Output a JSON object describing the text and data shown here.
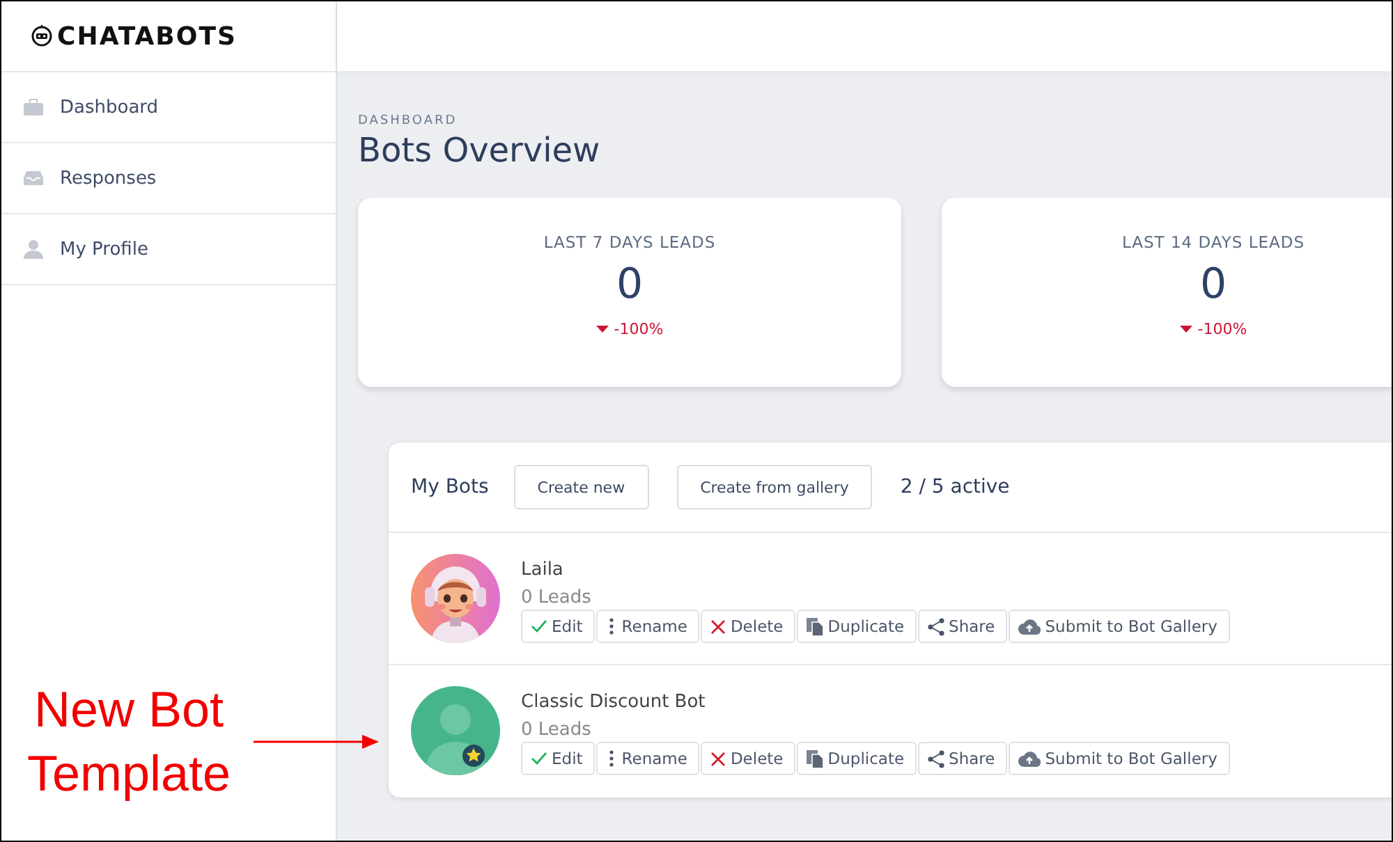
{
  "logo": {
    "text": "CHATABOTS"
  },
  "sidebar": {
    "items": [
      {
        "label": "Dashboard",
        "kind": "briefcase"
      },
      {
        "label": "Responses",
        "kind": "inbox"
      },
      {
        "label": "My Profile",
        "kind": "person"
      }
    ]
  },
  "page": {
    "breadcrumb": "DASHBOARD",
    "title": "Bots Overview"
  },
  "stats": [
    {
      "label": "LAST 7 DAYS LEADS",
      "value": "0",
      "change": "-100%"
    },
    {
      "label": "LAST 14 DAYS LEADS",
      "value": "0",
      "change": "-100%"
    }
  ],
  "bots_panel": {
    "title": "My Bots",
    "buttons": [
      "Create new",
      "Create from gallery"
    ],
    "active_count": "2 / 5 active",
    "bots": [
      {
        "name": "Laila",
        "leads": "0 Leads",
        "kind": "picture",
        "actions": [
          {
            "kind": "edit",
            "label": "Edit"
          },
          {
            "kind": "rename",
            "label": "Rename"
          },
          {
            "kind": "delete",
            "label": "Delete"
          },
          {
            "kind": "duplicate",
            "label": "Duplicate"
          },
          {
            "kind": "share",
            "label": "Share"
          },
          {
            "kind": "submit",
            "label": "Submit to Bot Gallery"
          }
        ]
      },
      {
        "name": "Classic Discount Bot",
        "leads": "0 Leads",
        "kind": "placeholder",
        "actions": [
          {
            "kind": "edit",
            "label": "Edit"
          },
          {
            "kind": "rename",
            "label": "Rename"
          },
          {
            "kind": "delete",
            "label": "Delete"
          },
          {
            "kind": "duplicate",
            "label": "Duplicate"
          },
          {
            "kind": "share",
            "label": "Share"
          },
          {
            "kind": "submit",
            "label": "Submit to Bot Gallery"
          }
        ]
      }
    ]
  },
  "annotation": {
    "text": "New Bot Template"
  }
}
